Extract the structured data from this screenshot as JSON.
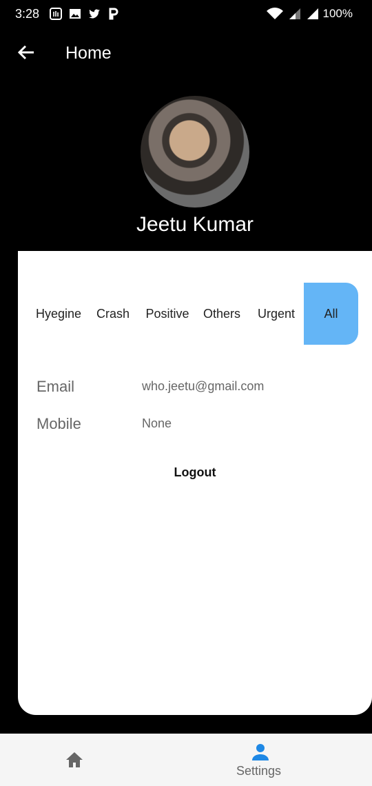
{
  "status": {
    "time": "3:28",
    "battery": "100%"
  },
  "appbar": {
    "title": "Home"
  },
  "profile": {
    "name": "Jeetu Kumar"
  },
  "tabs": [
    "Hyegine",
    "Crash",
    "Positive",
    "Others",
    "Urgent",
    "All"
  ],
  "info": {
    "email_label": "Email",
    "email_value": "who.jeetu@gmail.com",
    "mobile_label": "Mobile",
    "mobile_value": "None"
  },
  "logout_label": "Logout",
  "bottom_nav": {
    "settings_label": "Settings"
  },
  "colors": {
    "accent": "#64b5f6",
    "nav_active": "#1e88e5",
    "background": "#000000",
    "card": "#ffffff"
  },
  "icons": [
    "silent-mode-icon",
    "image-icon",
    "twitter-icon",
    "p-app-icon",
    "wifi-icon",
    "signal-icon",
    "battery-icon",
    "back-arrow-icon",
    "home-icon",
    "person-icon"
  ]
}
